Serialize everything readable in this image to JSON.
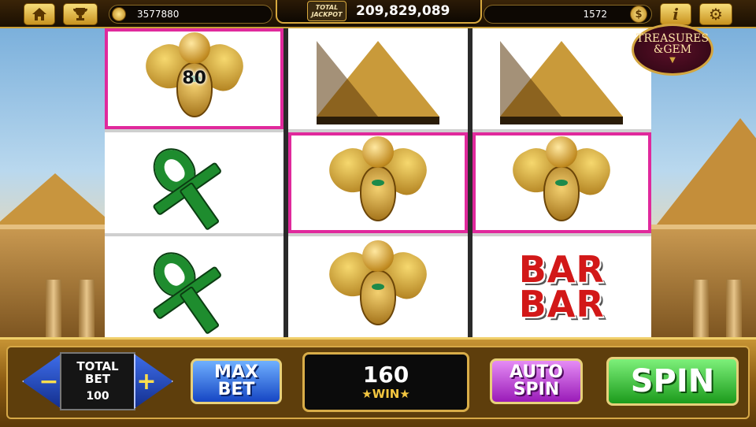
{
  "top_bar": {
    "coins": "3577880",
    "jackpot_label_top": "TOTAL",
    "jackpot_label_bottom": "JACKPOT",
    "jackpot_value": "209,829,089",
    "level": "1572",
    "info_label": "i",
    "dollar_label": "$"
  },
  "feature_badge": {
    "line1": "TREASURES",
    "line2": "&GEM"
  },
  "reels": [
    [
      "scarab",
      "ankh",
      "ankh"
    ],
    [
      "pyramid",
      "scarab",
      "scarab"
    ],
    [
      "pyramid",
      "scarab",
      "bar-bar"
    ]
  ],
  "highlighted_cells": [
    [
      0,
      0
    ],
    [
      1,
      1
    ],
    [
      2,
      1
    ]
  ],
  "multiplier": "80",
  "bar_symbol": {
    "line1": "BAR",
    "line2": "BAR"
  },
  "bottom_panel": {
    "total_bet_label_1": "TOTAL",
    "total_bet_label_2": "BET",
    "total_bet_value": "100",
    "minus_label": "−",
    "plus_label": "+",
    "max_bet_1": "MAX",
    "max_bet_2": "BET",
    "win_value": "160",
    "win_label": "WIN",
    "auto_spin_1": "AUTO",
    "auto_spin_2": "SPIN",
    "spin_label": "SPIN"
  },
  "colors": {
    "highlight": "#e0299c",
    "spin": "#1c9b1c",
    "auto_spin": "#9a1bb8",
    "max_bet": "#1646c4",
    "gold": "#d9ad48"
  }
}
